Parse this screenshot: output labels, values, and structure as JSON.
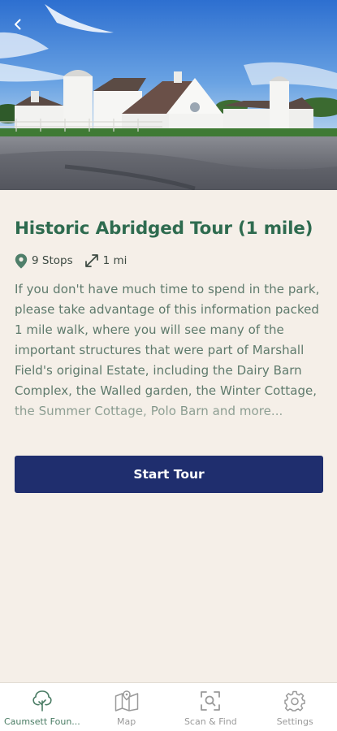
{
  "header": {
    "back_icon": "chevron-left-icon",
    "hero_image": "estate-barn-photo"
  },
  "tour": {
    "title": "Historic Abridged Tour (1 mile)",
    "stops_label": "9 Stops",
    "distance_label": "1 mi",
    "description": "If you don't have much time to spend in the park, please take advantage of this information packed 1 mile walk, where you will see many of the important structures that were part of Marshall Field's original Estate, including the Dairy Barn Complex, the Walled garden, the Winter Cottage, the Summer Cottage, Polo Barn and more...",
    "start_label": "Start Tour"
  },
  "nav": {
    "items": [
      {
        "label": "Caumsett Foun...",
        "icon": "tree-icon",
        "active": true
      },
      {
        "label": "Map",
        "icon": "map-icon",
        "active": false
      },
      {
        "label": "Scan & Find",
        "icon": "scan-icon",
        "active": false
      },
      {
        "label": "Settings",
        "icon": "gear-icon",
        "active": false
      }
    ]
  },
  "colors": {
    "accent_green": "#2e6b4f",
    "button_navy": "#1f2e6e",
    "background": "#f5efe8",
    "nav_inactive": "#9a9a9a"
  }
}
